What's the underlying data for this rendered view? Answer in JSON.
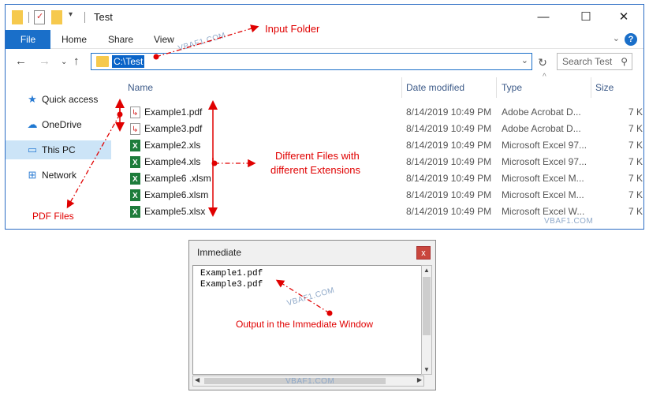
{
  "window": {
    "title": "Test",
    "minimize_glyph": "—",
    "maximize_glyph": "☐",
    "close_glyph": "✕"
  },
  "ribbon": {
    "file_tab": "File",
    "tabs": [
      "Home",
      "Share",
      "View"
    ]
  },
  "address": {
    "path": "C:\\Test",
    "search_placeholder": "Search Test"
  },
  "sidebar": {
    "items": [
      {
        "label": "Quick access",
        "icon": "star-icon"
      },
      {
        "label": "OneDrive",
        "icon": "cloud-icon"
      },
      {
        "label": "This PC",
        "icon": "monitor-icon"
      },
      {
        "label": "Network",
        "icon": "network-icon"
      }
    ]
  },
  "columns": {
    "name": "Name",
    "date": "Date modified",
    "type": "Type",
    "size": "Size"
  },
  "files": [
    {
      "name": "Example1.pdf",
      "kind": "pdf",
      "date": "8/14/2019 10:49 PM",
      "type": "Adobe Acrobat D...",
      "size": "7 K"
    },
    {
      "name": "Example3.pdf",
      "kind": "pdf",
      "date": "8/14/2019 10:49 PM",
      "type": "Adobe Acrobat D...",
      "size": "7 K"
    },
    {
      "name": "Example2.xls",
      "kind": "xls",
      "date": "8/14/2019 10:49 PM",
      "type": "Microsoft Excel 97...",
      "size": "7 K"
    },
    {
      "name": "Example4.xls",
      "kind": "xls",
      "date": "8/14/2019 10:49 PM",
      "type": "Microsoft Excel 97...",
      "size": "7 K"
    },
    {
      "name": "Example6 .xlsm",
      "kind": "xls",
      "date": "8/14/2019 10:49 PM",
      "type": "Microsoft Excel M...",
      "size": "7 K"
    },
    {
      "name": "Example6.xlsm",
      "kind": "xls",
      "date": "8/14/2019 10:49 PM",
      "type": "Microsoft Excel M...",
      "size": "7 K"
    },
    {
      "name": "Example5.xlsx",
      "kind": "xls",
      "date": "8/14/2019 10:49 PM",
      "type": "Microsoft Excel W...",
      "size": "7 K"
    }
  ],
  "annotations": {
    "input_folder": "Input Folder",
    "different_files_1": "Different Files with",
    "different_files_2": "different  Extensions",
    "pdf_files": "PDF Files",
    "output": "Output in the Immediate Window",
    "watermark": "VBAF1.COM",
    "color": "#e00000"
  },
  "immediate": {
    "title": "Immediate",
    "close_glyph": "x",
    "lines": [
      "Example1.pdf",
      "Example3.pdf"
    ]
  }
}
